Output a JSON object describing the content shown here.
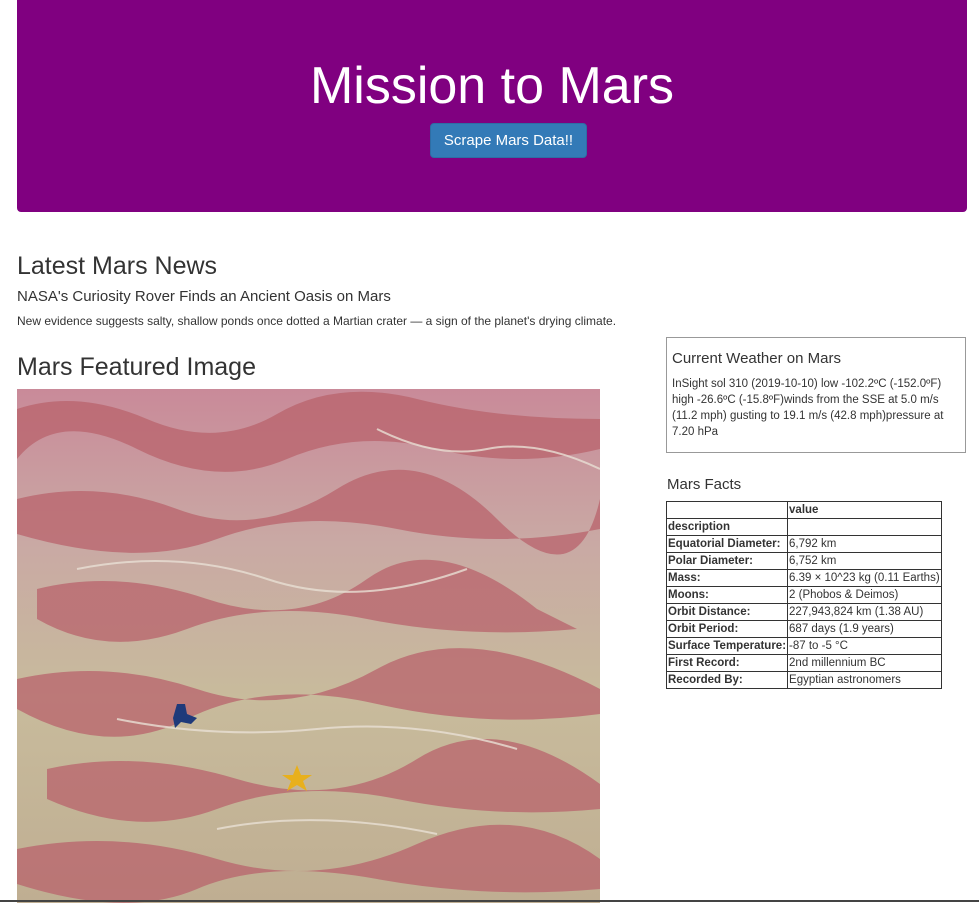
{
  "header": {
    "title": "Mission to Mars",
    "scrape_button": "Scrape Mars Data!!"
  },
  "news": {
    "heading": "Latest Mars News",
    "title": "NASA's Curiosity Rover Finds an Ancient Oasis on Mars",
    "teaser": "New evidence suggests salty, shallow ponds once dotted a Martian crater — a sign of the planet's drying climate."
  },
  "featured": {
    "heading": "Mars Featured Image"
  },
  "weather": {
    "title": "Current Weather on Mars",
    "text": "InSight sol 310 (2019-10-10) low -102.2ºC (-152.0ºF) high -26.6ºC (-15.8ºF)winds from the SSE at 5.0 m/s (11.2 mph) gusting to 19.1 m/s (42.8 mph)pressure at 7.20 hPa"
  },
  "facts": {
    "heading": "Mars Facts",
    "column_header": "value",
    "index_label": "description",
    "rows": [
      {
        "label": "Equatorial Diameter:",
        "value": "6,792 km"
      },
      {
        "label": "Polar Diameter:",
        "value": "6,752 km"
      },
      {
        "label": "Mass:",
        "value": "6.39 × 10^23 kg (0.11 Earths)"
      },
      {
        "label": "Moons:",
        "value": "2 (Phobos & Deimos)"
      },
      {
        "label": "Orbit Distance:",
        "value": "227,943,824 km (1.38 AU)"
      },
      {
        "label": "Orbit Period:",
        "value": "687 days (1.9 years)"
      },
      {
        "label": "Surface Temperature:",
        "value": "-87 to -5 °C"
      },
      {
        "label": "First Record:",
        "value": "2nd millennium BC"
      },
      {
        "label": "Recorded By:",
        "value": "Egyptian astronomers"
      }
    ]
  },
  "colors": {
    "header_bg": "#800080",
    "button_bg": "#337ab7"
  }
}
